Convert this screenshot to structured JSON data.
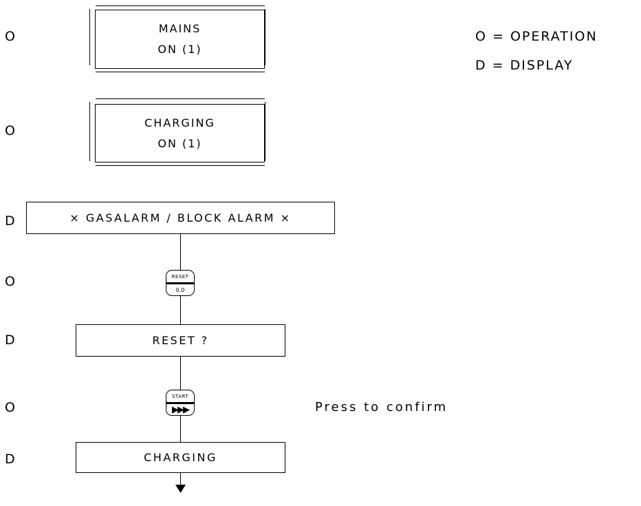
{
  "legend": {
    "operation": "O = OPERATION",
    "display": "D = DISPLAY"
  },
  "steps": [
    {
      "marker": "O",
      "line1": "MAINS",
      "line2": "ON (1)"
    },
    {
      "marker": "O",
      "line1": "CHARGING",
      "line2": "ON (1)"
    },
    {
      "marker": "D",
      "text": "× GASALARM / BLOCK ALARM ×"
    },
    {
      "marker": "O",
      "button_top": "RESET",
      "button_bottom": "0.0"
    },
    {
      "marker": "D",
      "text": "RESET ?"
    },
    {
      "marker": "O",
      "button_top": "START",
      "button_bottom": "▶▶▶",
      "note": "Press to confirm"
    },
    {
      "marker": "D",
      "text": "CHARGING"
    }
  ]
}
